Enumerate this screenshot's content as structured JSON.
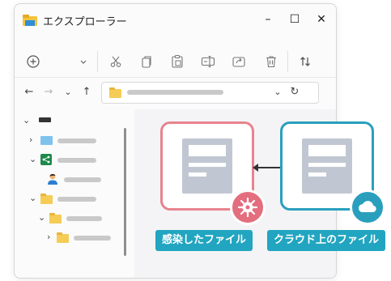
{
  "window": {
    "title": "エクスプローラー",
    "minimize_glyph": "–",
    "maximize_glyph": "☐",
    "close_glyph": "✕"
  },
  "toolbar": {
    "icons": [
      "new-icon",
      "chevron-down-icon",
      "cut-icon",
      "copy-icon",
      "paste-icon",
      "rename-icon",
      "share-icon",
      "delete-icon",
      "sort-icon"
    ]
  },
  "navigation": {
    "back_glyph": "←",
    "forward_glyph": "→",
    "recent_glyph": "⌄",
    "up_glyph": "↑",
    "dropdown_glyph": "⌄",
    "refresh_glyph": "↻"
  },
  "cards": {
    "infected_label": "感染したファイル",
    "cloud_label": "クラウド上のファイル"
  },
  "colors": {
    "infected_border": "#e8838e",
    "infected_badge": "#e36e7e",
    "cloud_border": "#2a9fbd",
    "cloud_badge": "#2a9fbd",
    "label_bg": "#22a5c1"
  }
}
